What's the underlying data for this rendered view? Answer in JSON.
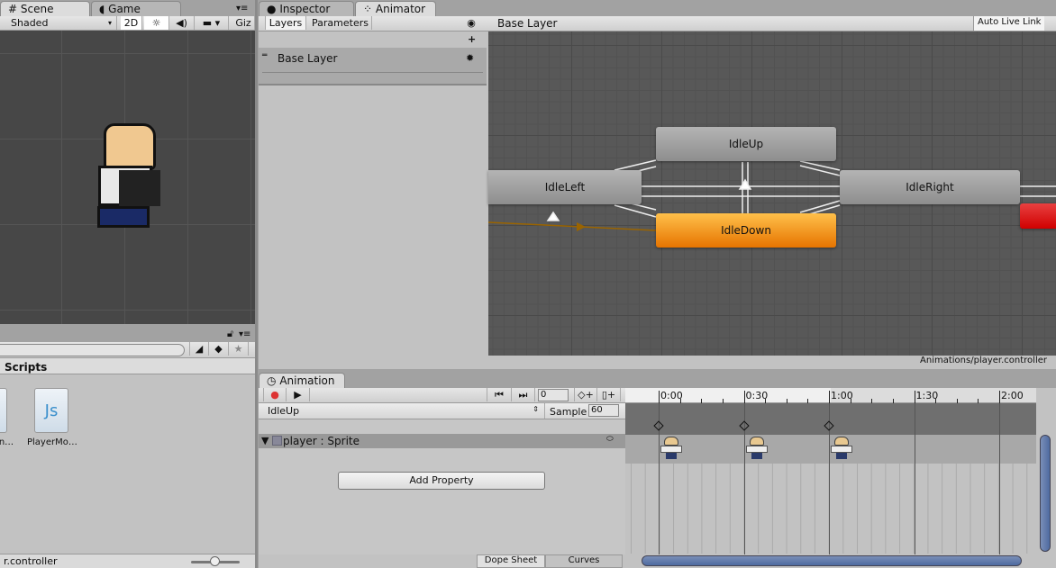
{
  "left_tabs": [
    {
      "label": "Scene",
      "icon": "grid-icon"
    },
    {
      "label": "Game",
      "icon": "pacman-icon"
    }
  ],
  "scene_toolbar": {
    "shading": "Shaded",
    "mode_2d": "2D",
    "gizmos": "Giz"
  },
  "project": {
    "breadcrumb": "Scripts",
    "assets": [
      {
        "name": "An…",
        "icon": "script-icon"
      },
      {
        "name": "PlayerMo…",
        "icon": "js-script-icon",
        "glyph": "Js"
      }
    ],
    "footer_path": "r.controller"
  },
  "right_tabs": [
    {
      "label": "Inspector",
      "icon": "info-icon"
    },
    {
      "label": "Animator",
      "icon": "animator-icon"
    }
  ],
  "animator": {
    "layer_tabs": [
      "Layers",
      "Parameters"
    ],
    "add_label": "+",
    "layers": [
      {
        "name": "Base Layer"
      }
    ],
    "breadcrumb": "Base Layer",
    "auto_live_link": "Auto Live Link",
    "footer_path": "Animations/player.controller",
    "states": [
      {
        "name": "IdleUp",
        "default": false
      },
      {
        "name": "IdleLeft",
        "default": false
      },
      {
        "name": "IdleRight",
        "default": false
      },
      {
        "name": "IdleDown",
        "default": true
      }
    ],
    "colors": {
      "default_state": "#f08c00",
      "any_state": "#d40000",
      "transition_entry": "#9a6400"
    }
  },
  "animation": {
    "tab": "Animation",
    "frame": "0",
    "clip": "IdleUp",
    "sample_label": "Sample",
    "sample": "60",
    "property": "player : Sprite",
    "add_property": "Add Property",
    "bottom_tabs": [
      "Dope Sheet",
      "Curves"
    ],
    "time_labels": [
      "0:00",
      "0:30",
      "1:00",
      "1:30",
      "2:00"
    ],
    "keyframes": [
      "0:00",
      "0:30",
      "1:00"
    ]
  }
}
